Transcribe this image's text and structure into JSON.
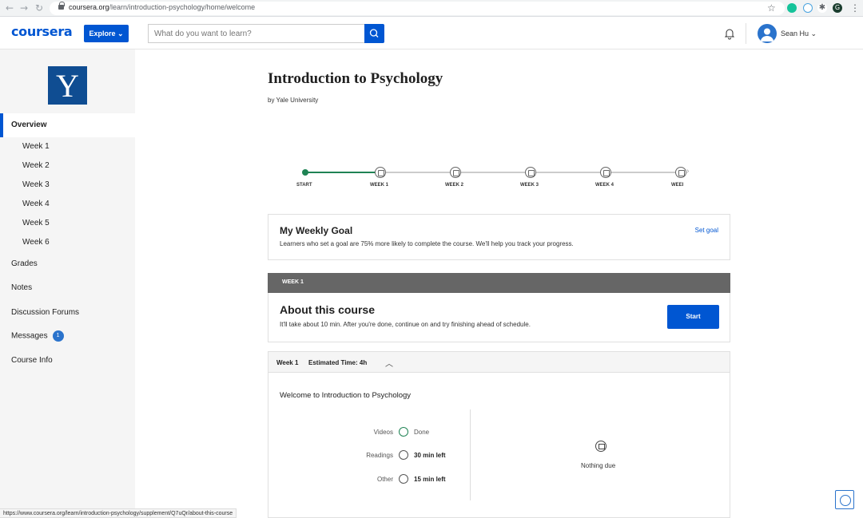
{
  "browser": {
    "url_domain": "coursera.org",
    "url_path": "/learn/introduction-psychology/home/welcome",
    "back": "←",
    "forward": "→",
    "reload": "↻",
    "star": "☆",
    "menu": "⋮",
    "profile_letter": "G"
  },
  "header": {
    "logo": "coursera",
    "explore_label": "Explore ⌄",
    "search_placeholder": "What do you want to learn?",
    "user_name": "Sean Hu ⌄"
  },
  "sidebar": {
    "logo_letter": "Y",
    "overview": "Overview",
    "weeks": [
      "Week 1",
      "Week 2",
      "Week 3",
      "Week 4",
      "Week 5",
      "Week 6"
    ],
    "grades": "Grades",
    "notes": "Notes",
    "forums": "Discussion Forums",
    "messages": "Messages",
    "messages_count": "1",
    "course_info": "Course Info"
  },
  "course": {
    "title": "Introduction to Psychology",
    "byline": "by Yale University"
  },
  "timeline": {
    "labels": [
      "START",
      "WEEK 1",
      "WEEK 2",
      "WEEK 3",
      "WEEK 4",
      "WEEI"
    ],
    "next_arrow": "›"
  },
  "goal": {
    "title": "My Weekly Goal",
    "description": "Learners who set a goal are 75% more likely to complete the course. We'll help you track your progress.",
    "link": "Set goal"
  },
  "week1": {
    "header": "WEEK 1",
    "about_title": "About this course",
    "about_desc": "It'll take about 10 min. After you're done, continue on and try finishing ahead of schedule.",
    "start_label": "Start",
    "summary_week": "Week 1",
    "summary_time": "Estimated Time: 4h",
    "collapse_chevron": "︿",
    "welcome": "Welcome to Introduction to Psychology",
    "progress": [
      {
        "label": "Videos",
        "value": "Done"
      },
      {
        "label": "Readings",
        "value": "30 min left"
      },
      {
        "label": "Other",
        "value": "15 min left"
      }
    ],
    "nothing_due": "Nothing due"
  },
  "status_url": "https://www.coursera.org/learn/introduction-psychology/supplement/Q7uQr/about-this-course",
  "colors": {
    "brand": "#0056d2",
    "success": "#1f8354",
    "yale": "#0f4d92"
  }
}
